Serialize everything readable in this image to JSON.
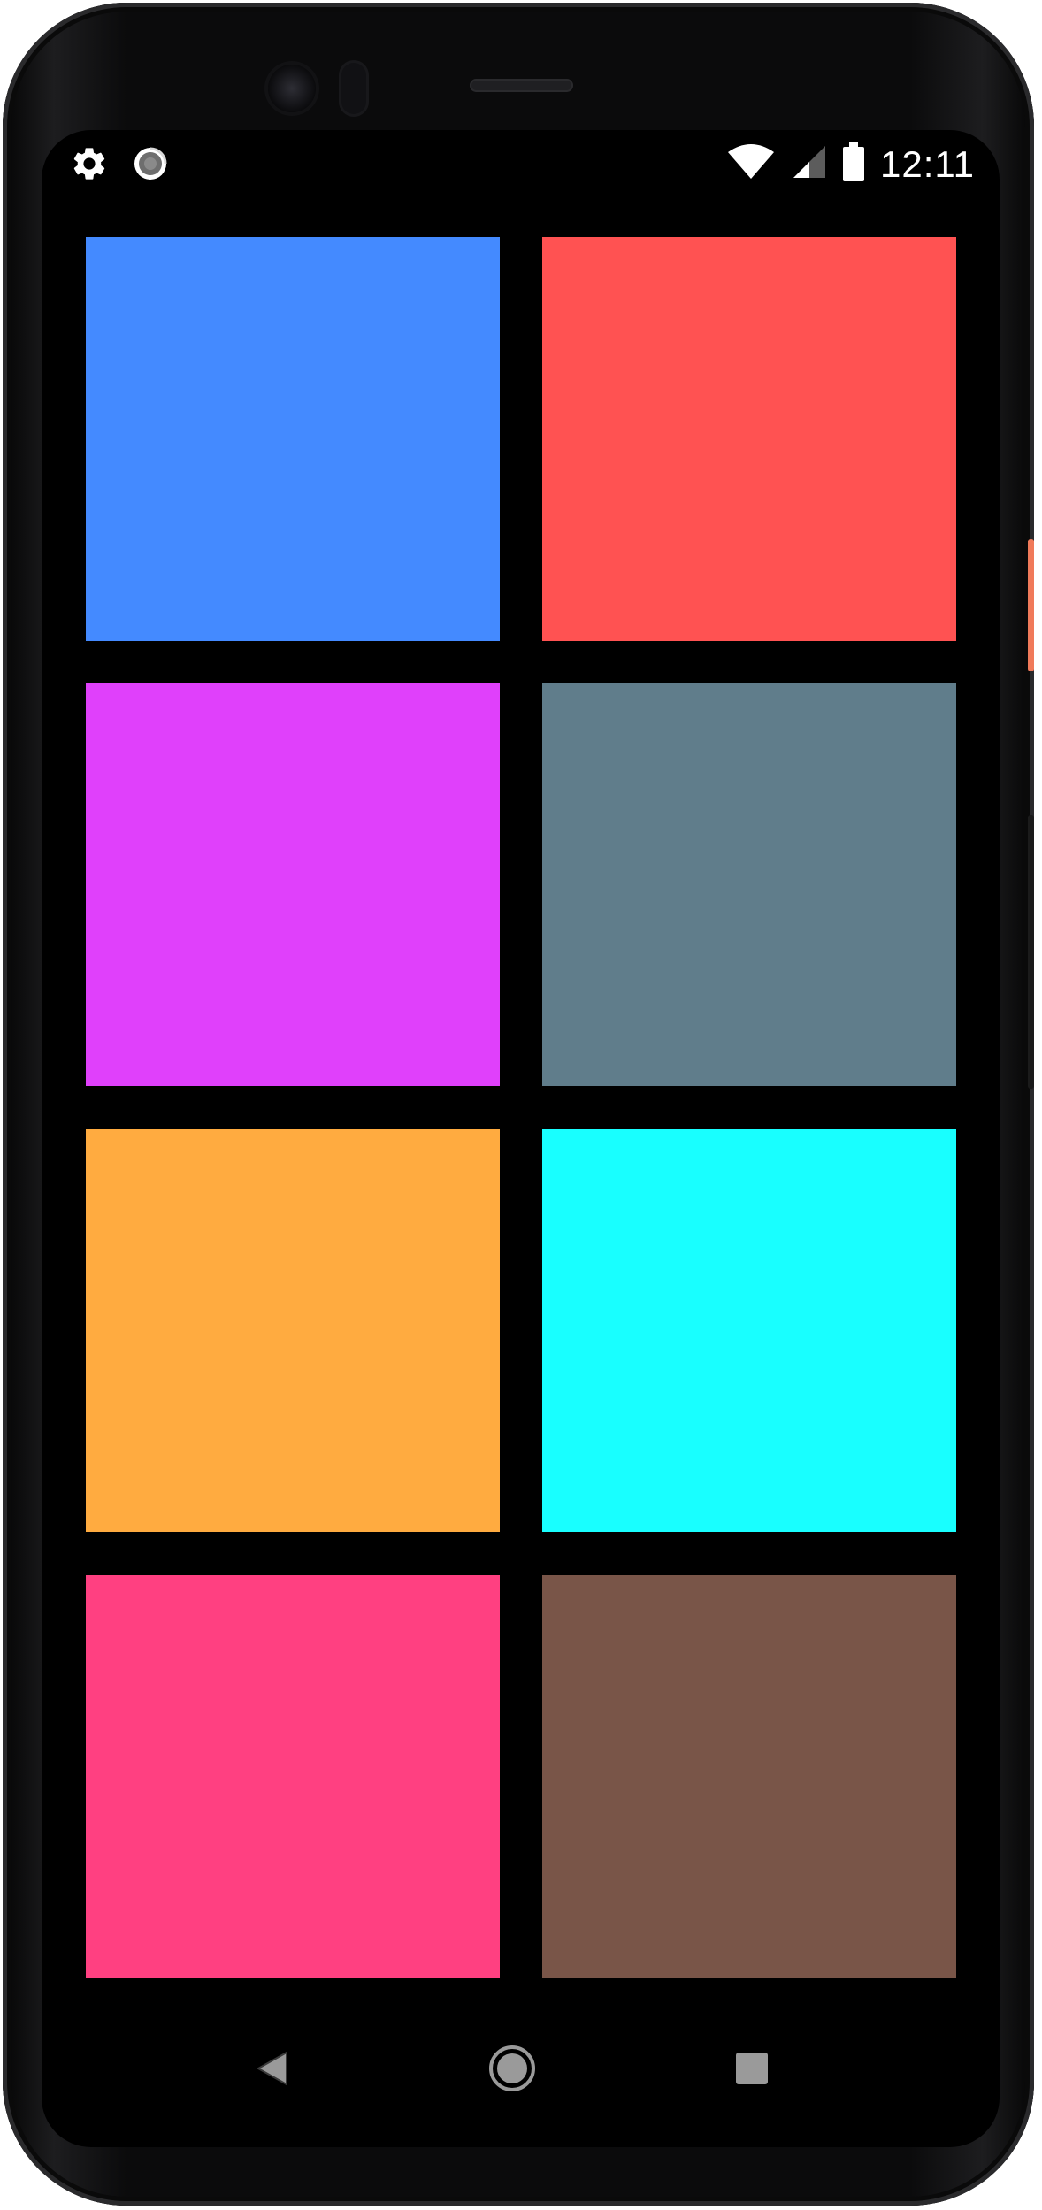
{
  "status_bar": {
    "time": "12:11",
    "left_icons": [
      "gear-icon",
      "loading-spinner-icon"
    ],
    "right_icons": [
      "wifi-icon",
      "signal-icon",
      "battery-icon"
    ]
  },
  "tiles": [
    {
      "color": "#448aff"
    },
    {
      "color": "#ff5252"
    },
    {
      "color": "#e040fb"
    },
    {
      "color": "#607d8b"
    },
    {
      "color": "#ffab40"
    },
    {
      "color": "#18ffff"
    },
    {
      "color": "#ff4081"
    },
    {
      "color": "#795548"
    }
  ],
  "navigation": {
    "buttons": [
      "back-icon",
      "home-icon",
      "recents-icon"
    ],
    "icon_color": "#9a9a9a"
  },
  "colors": {
    "screen_background": "#000000",
    "status_icon": "#ffffff",
    "device_frame": "#0b0b0c",
    "side_button_accent": "#f07a5a"
  }
}
